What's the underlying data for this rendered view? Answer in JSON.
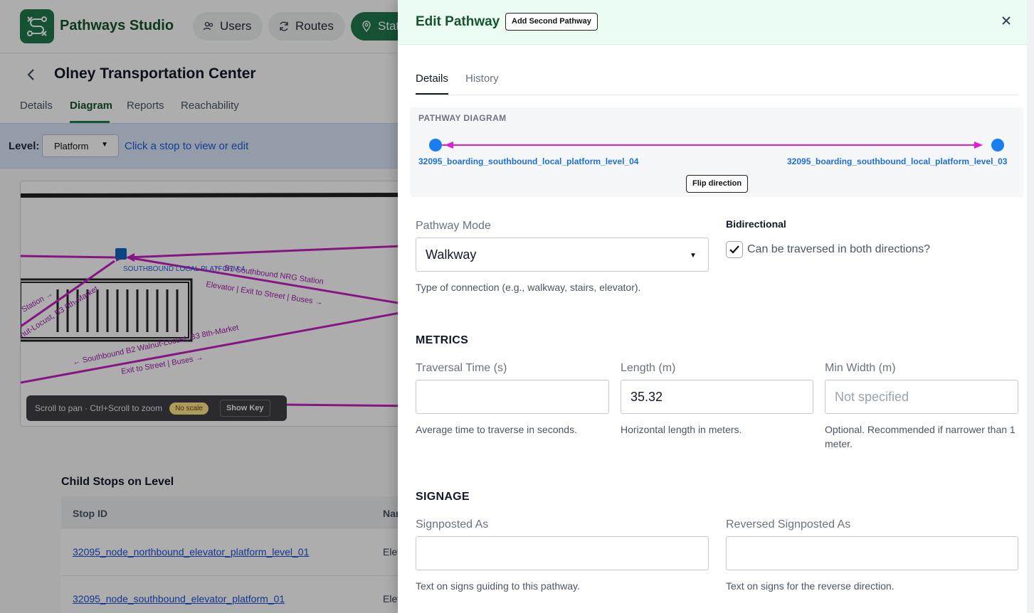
{
  "app": {
    "brand": "Pathways Studio",
    "nav": [
      {
        "label": "Users"
      },
      {
        "label": "Routes"
      },
      {
        "label": "Stat"
      }
    ]
  },
  "station": {
    "title": "Olney Transportation Center",
    "tabs": [
      "Details",
      "Diagram",
      "Reports",
      "Reachability"
    ],
    "active_tab": "Diagram"
  },
  "level_bar": {
    "label": "Level:",
    "selected": "Platform",
    "hint": "Click a stop to view or edit"
  },
  "diagram_labels": {
    "platform": "SOUTHBOUND LOCAL PLATFORM 4",
    "label_b1": "← B1 Southbound NRG Station",
    "label_b1_sub": "Elevator | Exit to Street | Buses →",
    "label_left1": "G Station →",
    "label_left2": "nut-Locust, B3 8th-Market",
    "label_b2": "← Southbound B2 Walnut-Locust, B3 8th-Market",
    "label_b2_sub": "Exit to Street | Buses →"
  },
  "map_hint": {
    "text": "Scroll to pan · Ctrl+Scroll to zoom",
    "badge": "No scale",
    "button": "Show Key"
  },
  "child_stops": {
    "title": "Child Stops on Level",
    "headers": [
      "Stop ID",
      "Nar"
    ],
    "rows": [
      {
        "id": "32095_node_northbound_elevator_platform_level_01",
        "name": "Elev"
      },
      {
        "id": "32095_node_southbound_elevator_platform_01",
        "name": "Elev"
      }
    ]
  },
  "drawer": {
    "title": "Edit Pathway",
    "add_button": "Add Second Pathway",
    "tabs": [
      "Details",
      "History"
    ],
    "active_tab": "Details",
    "diagram": {
      "heading": "PATHWAY DIAGRAM",
      "from": "32095_boarding_southbound_local_platform_level_04",
      "to": "32095_boarding_southbound_local_platform_level_03",
      "flip_button": "Flip direction",
      "accent": "#e21bd7",
      "node_color": "#1a7ef0"
    },
    "mode": {
      "label": "Pathway Mode",
      "value": "Walkway",
      "help": "Type of connection (e.g., walkway, stairs, elevator)."
    },
    "bidirectional": {
      "label": "Bidirectional",
      "checkbox_label": "Can be traversed in both directions?",
      "checked": true
    },
    "metrics": {
      "heading": "METRICS",
      "traversal": {
        "label": "Traversal Time (s)",
        "value": "",
        "help": "Average time to traverse in seconds."
      },
      "length": {
        "label": "Length (m)",
        "value": "35.32",
        "help": "Horizontal length in meters."
      },
      "min_width": {
        "label": "Min Width (m)",
        "placeholder": "Not specified",
        "help": "Optional. Recommended if narrower than 1 meter."
      }
    },
    "signage": {
      "heading": "SIGNAGE",
      "signposted": {
        "label": "Signposted As",
        "value": "",
        "help": "Text on signs guiding to this pathway."
      },
      "reversed": {
        "label": "Reversed Signposted As",
        "value": "",
        "help": "Text on signs for the reverse direction."
      }
    }
  }
}
